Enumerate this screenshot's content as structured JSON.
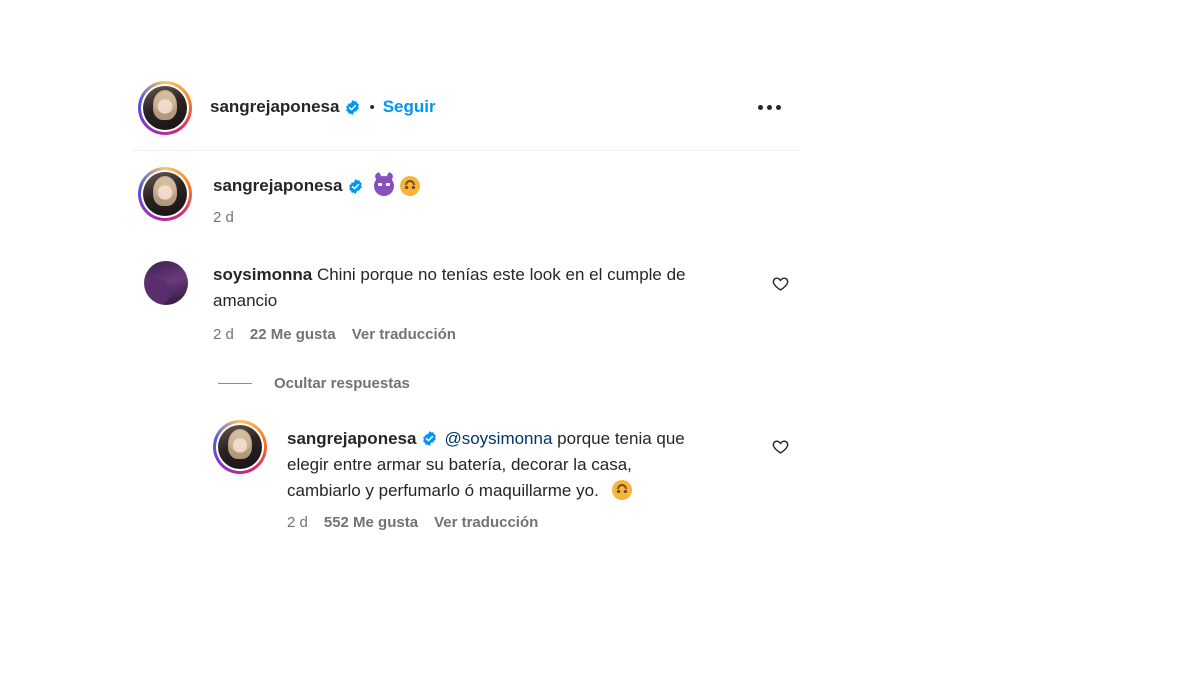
{
  "post_header": {
    "username": "sangrejaponesa",
    "separator": "•",
    "follow_label": "Seguir"
  },
  "caption": {
    "username": "sangrejaponesa",
    "emojis": [
      "smiling-imp-emoji",
      "upside-down-face-emoji"
    ],
    "time": "2 d"
  },
  "comment": {
    "username": "soysimonna",
    "text_line1": "Chini porque no tenías este look en el cumple de",
    "text_line2": "amancio",
    "time": "2 d",
    "likes": "22 Me gusta",
    "translate_label": "Ver traducción"
  },
  "replies_toggle": {
    "label": "Ocultar respuestas"
  },
  "reply": {
    "username": "sangrejaponesa",
    "mention": "@soysimonna",
    "text_line1": "porque tenia que",
    "text_line2": "elegir entre armar su batería, decorar la casa,",
    "text_line3": "cambiarlo y perfumarlo ó maquillarme yo.",
    "emoji": "upside-down-face-emoji",
    "time": "2 d",
    "likes": "552 Me gusta",
    "translate_label": "Ver traducción"
  },
  "colors": {
    "accent_blue": "#0095f6",
    "mention_blue": "#00376b",
    "verified_blue": "#0095f6",
    "meta_gray": "#737373"
  }
}
